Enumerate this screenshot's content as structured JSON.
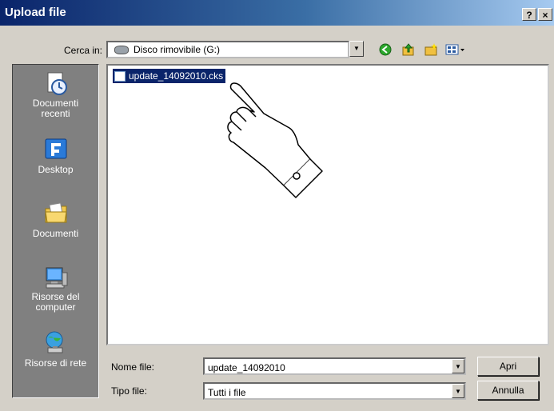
{
  "window": {
    "title": "Upload file",
    "help_label": "?",
    "close_label": "×"
  },
  "lookin": {
    "label": "Cerca in:",
    "value": "Disco rimovibile (G:)"
  },
  "toolbar": {
    "icons": [
      "back-icon",
      "up-folder-icon",
      "new-folder-icon",
      "view-menu-icon"
    ]
  },
  "places": [
    {
      "label": "Documenti recenti",
      "icon": "recent-documents-icon"
    },
    {
      "label": "Desktop",
      "icon": "desktop-icon"
    },
    {
      "label": "Documenti",
      "icon": "documents-folder-icon"
    },
    {
      "label": "Risorse del computer",
      "icon": "my-computer-icon"
    },
    {
      "label": "Risorse di rete",
      "icon": "network-icon"
    }
  ],
  "files": [
    {
      "name": "update_14092010.cks",
      "selected": true
    }
  ],
  "filename": {
    "label": "Nome file:",
    "value": "update_14092010"
  },
  "filetype": {
    "label": "Tipo file:",
    "value": "Tutti i file"
  },
  "buttons": {
    "open": "Apri",
    "cancel": "Annulla"
  },
  "colors": {
    "titlebar_start": "#0a246a",
    "titlebar_end": "#a6caf0",
    "selection": "#0a246a",
    "dialog_bg": "#d4d0c8"
  }
}
